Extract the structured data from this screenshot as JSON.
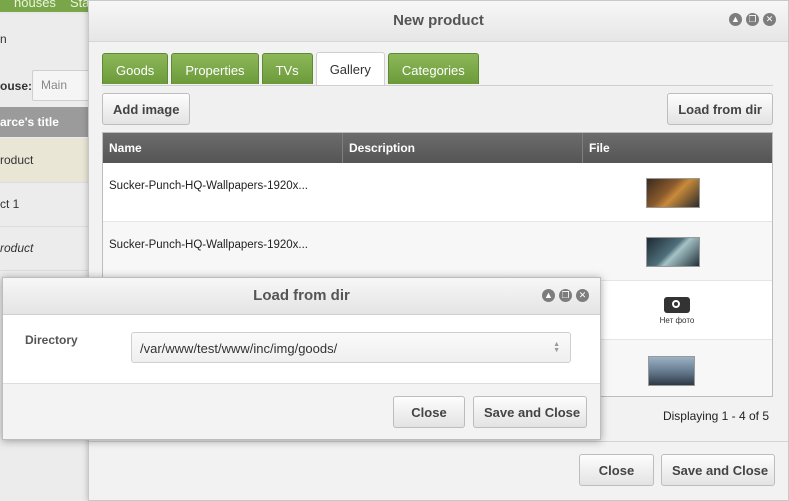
{
  "background": {
    "tabs": [
      "houses",
      "Stat",
      "..."
    ],
    "left_partial": "n",
    "warehouse_label": "ouse:",
    "warehouse_value": "Main",
    "grid_header": "arce's title",
    "rows": [
      "roduct",
      "ct 1",
      "roduct"
    ]
  },
  "window": {
    "title": "New product",
    "controls": [
      "▲",
      "❐",
      "✕"
    ],
    "tabs": [
      "Goods",
      "Properties",
      "TVs",
      "Gallery",
      "Categories"
    ],
    "active_tab": "Gallery",
    "toolbar": {
      "add_image": "Add image",
      "load_from_dir": "Load from dir"
    },
    "grid": {
      "columns": [
        "Name",
        "Description",
        "File"
      ],
      "rows": [
        {
          "name": "Sucker-Punch-HQ-Wallpapers-1920x...",
          "description": "",
          "file": "image"
        },
        {
          "name": "Sucker-Punch-HQ-Wallpapers-1920x...",
          "description": "",
          "file": "image"
        },
        {
          "name": "",
          "description": "",
          "file": "Нет фото"
        },
        {
          "name": "",
          "description": "",
          "file": "image"
        }
      ]
    },
    "paging": "Displaying 1 - 4 of 5",
    "footer": {
      "close": "Close",
      "save_close": "Save and Close"
    }
  },
  "dialog": {
    "title": "Load from dir",
    "controls": [
      "▲",
      "❐",
      "✕"
    ],
    "directory_label": "Directory",
    "directory_value": "/var/www/test/www/inc/img/goods/",
    "close": "Close",
    "save_close": "Save and Close"
  }
}
